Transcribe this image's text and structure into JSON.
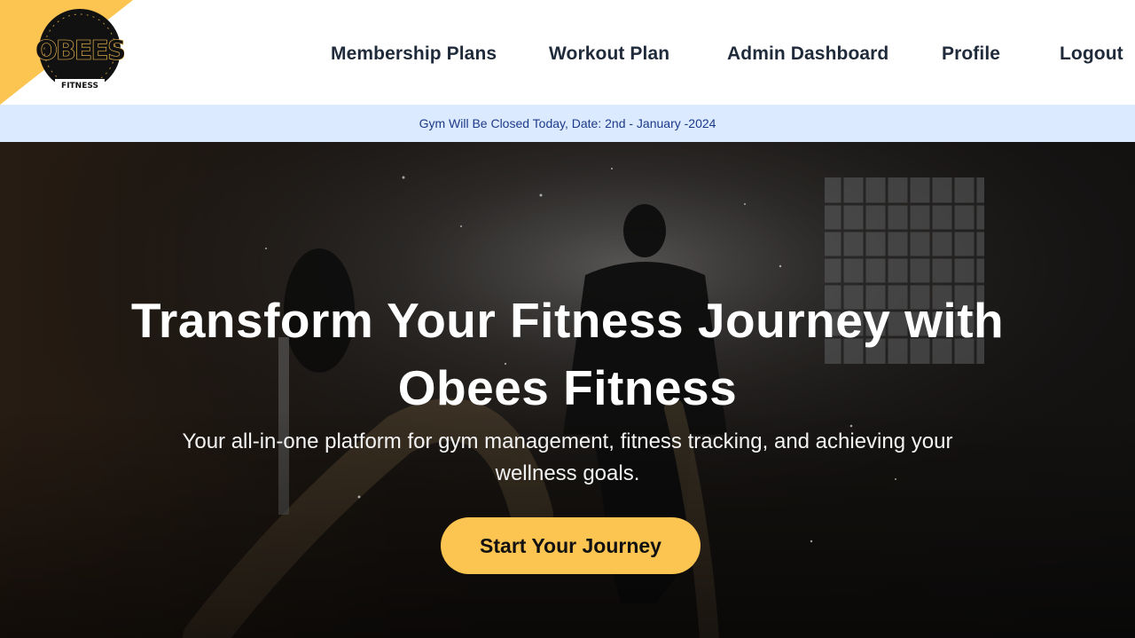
{
  "brand": {
    "logo_text": "OBEES",
    "logo_subtext": "FITNESS",
    "accent_color": "#fcc451"
  },
  "nav": {
    "items": [
      {
        "label": "Membership Plans"
      },
      {
        "label": "Workout Plan"
      },
      {
        "label": "Admin Dashboard"
      },
      {
        "label": "Profile"
      },
      {
        "label": "Logout"
      }
    ]
  },
  "announcement": {
    "text": "Gym Will Be Closed Today, Date: 2nd - January -2024",
    "background": "#dbeafe",
    "color": "#1e3a8a"
  },
  "hero": {
    "title_line1": "Transform Your Fitness Journey with",
    "title_line2": "Obees Fitness",
    "subtitle": "Your all-in-one platform for gym management, fitness tracking, and achieving your wellness goals.",
    "cta_label": "Start Your Journey"
  }
}
